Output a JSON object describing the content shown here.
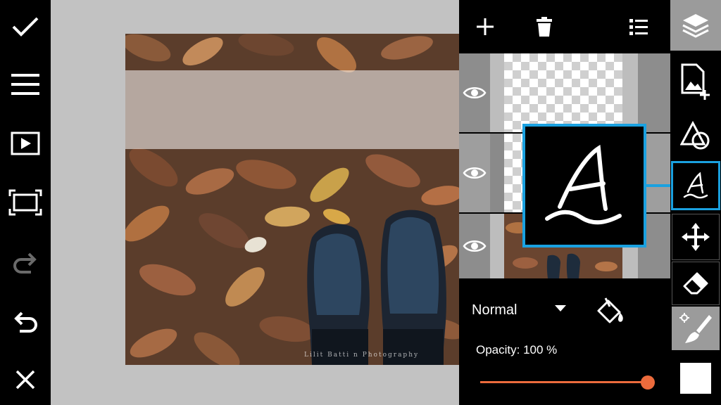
{
  "left_toolbar": {
    "items": [
      {
        "name": "confirm",
        "icon": "check-icon"
      },
      {
        "name": "menu",
        "icon": "hamburger-menu-icon"
      },
      {
        "name": "play",
        "icon": "play-icon"
      },
      {
        "name": "fit-screen",
        "icon": "fit-screen-icon"
      },
      {
        "name": "redo",
        "icon": "redo-icon"
      },
      {
        "name": "undo",
        "icon": "undo-icon"
      },
      {
        "name": "close",
        "icon": "close-icon"
      }
    ]
  },
  "canvas": {
    "watermark": "Lilit Batti   n Photography"
  },
  "layers_panel": {
    "top_tools": [
      {
        "name": "add-layer",
        "icon": "plus-icon"
      },
      {
        "name": "delete-layer",
        "icon": "trash-icon"
      },
      {
        "name": "layer-list",
        "icon": "list-icon"
      }
    ],
    "layers": [
      {
        "type": "text",
        "visible": true,
        "icon": "eye-icon"
      },
      {
        "type": "text",
        "visible": true,
        "selected": true,
        "icon": "eye-icon"
      },
      {
        "type": "photo",
        "visible": true,
        "icon": "eye-icon"
      }
    ],
    "blend_mode": "Normal",
    "opacity_label": "Opacity:  100 %",
    "opacity_value": 100
  },
  "right_toolbar": {
    "items": [
      {
        "name": "layers",
        "icon": "layers-icon",
        "active": true
      },
      {
        "name": "add-image",
        "icon": "add-image-icon"
      },
      {
        "name": "shapes",
        "icon": "shapes-icon"
      },
      {
        "name": "text",
        "icon": "text-icon",
        "selected": true
      },
      {
        "name": "move",
        "icon": "move-icon"
      },
      {
        "name": "eraser",
        "icon": "eraser-icon"
      },
      {
        "name": "brush",
        "icon": "brush-icon"
      },
      {
        "name": "color",
        "icon": "color-swatch-icon"
      }
    ]
  },
  "colors": {
    "accent_blue": "#1aa1e0",
    "slider_orange": "#ec6b3c",
    "canvas_gray": "#c2c2c2"
  }
}
